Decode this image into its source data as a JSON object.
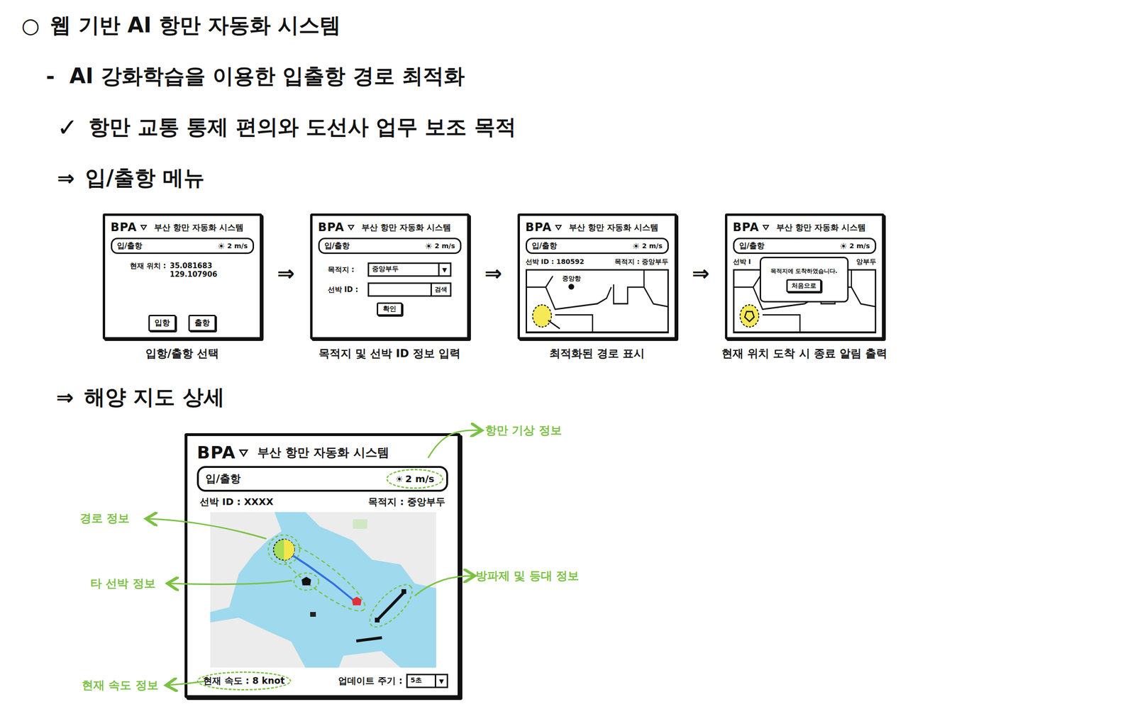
{
  "title": {
    "bullet": "○",
    "text": "웹 기반 AI 항만 자동화 시스템"
  },
  "subtitle": {
    "bullet": "-",
    "text": "AI 강화학습을 이용한 입출항 경로 최적화"
  },
  "purpose": {
    "bullet": "✓",
    "text": "항만 교통 통제 편의와 도선사 업무 보조 목적"
  },
  "menu_section": {
    "arrow": "⇒",
    "title": "입/출항 메뉴"
  },
  "app": {
    "logo": "BPA",
    "title": "부산 항만 자동화 시스템",
    "menu": "입/출항",
    "weather_icon": "☀",
    "weather": "2 m/s"
  },
  "flow_arrow": "⇒",
  "screens": [
    {
      "kind": "select",
      "location_label": "현재 위치 :",
      "location": [
        "35.081683",
        "129.107906"
      ],
      "buttons": [
        "입항",
        "출항"
      ],
      "caption": "입항/출항 선택"
    },
    {
      "kind": "input",
      "fields": [
        {
          "label": "목적지 :",
          "value": "중앙부두",
          "button": "▼"
        },
        {
          "label": "선박 ID :",
          "value": "",
          "button": "검색"
        }
      ],
      "confirm": "확인",
      "caption": "목적지 및 선박 ID 정보 입력"
    },
    {
      "kind": "route",
      "left": "선박 ID : 180592",
      "right": "목적지 : 중앙부두",
      "place": "중앙항",
      "caption": "최적화된 경로 표시"
    },
    {
      "kind": "arrived",
      "left": "선박 I",
      "right": "앙부두",
      "message": "목적지에 도착하였습니다.",
      "button": "처음으로",
      "caption": "현재 위치 도착 시 종료 알림 출력"
    }
  ],
  "detail_section": {
    "arrow": "⇒",
    "title": "해양 지도 상세"
  },
  "detail": {
    "ship_id": "선박 ID : XXXX",
    "destination": "목적지 : 중앙부두",
    "speed": "현재 속도 : 8 knot",
    "update_label": "업데이트 주기 :",
    "update_value": "5초",
    "dropdown_icon": "▼"
  },
  "annotations": [
    "항만 기상 정보",
    "경로 정보",
    "타 선박 정보",
    "방파제 및 등대 정보",
    "현재 속도 정보"
  ]
}
